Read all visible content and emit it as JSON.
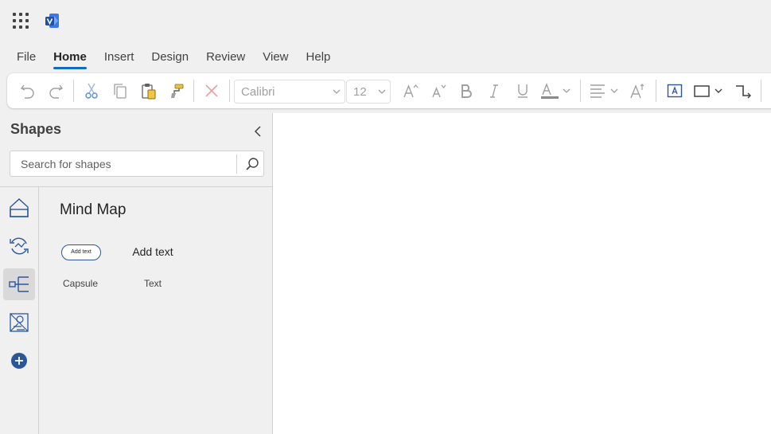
{
  "menu_tabs": [
    {
      "label": "File"
    },
    {
      "label": "Home",
      "active": true
    },
    {
      "label": "Insert"
    },
    {
      "label": "Design"
    },
    {
      "label": "Review"
    },
    {
      "label": "View"
    },
    {
      "label": "Help"
    }
  ],
  "ribbon": {
    "font_name": "Calibri",
    "font_size": "12",
    "icons": [
      "undo-icon",
      "redo-icon",
      "cut-icon",
      "copy-icon",
      "paste-icon",
      "format-painter-icon",
      "delete-icon",
      "increase-font-icon",
      "decrease-font-icon",
      "bold-icon",
      "italic-icon",
      "underline-icon",
      "font-color-icon",
      "align-icon",
      "text-style-icon",
      "text-box-icon",
      "rectangle-icon",
      "connector-icon"
    ]
  },
  "shapes_panel": {
    "title": "Shapes",
    "search_placeholder": "Search for shapes",
    "stencil_title": "Mind Map",
    "rail_icons": [
      "basic-shapes-icon",
      "cycle-icon",
      "mind-map-icon",
      "engineering-icon",
      "more-shapes-icon"
    ],
    "shapes": [
      {
        "label": "Capsule",
        "preview_text": "Add text"
      },
      {
        "label": "Text",
        "preview_text": "Add text"
      }
    ]
  },
  "colors": {
    "accent": "#0f6cbd",
    "visio_blue": "#2b579a",
    "background": "#f0f0f0",
    "canvas": "#ffffff"
  }
}
